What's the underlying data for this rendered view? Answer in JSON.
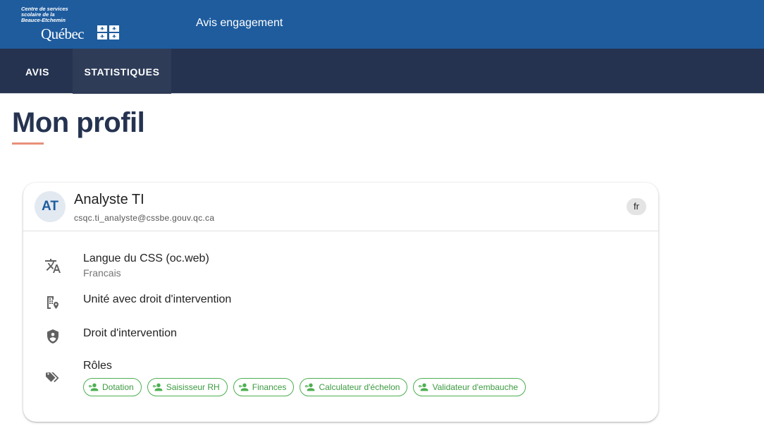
{
  "header": {
    "logo": {
      "org_line1": "Centre de services",
      "org_line2": "scolaire de la",
      "org_line3": "Beauce-Etchemin",
      "wordmark": "Québec"
    },
    "app_title": "Avis engagement",
    "color": "#1e5c9e"
  },
  "nav": {
    "items": [
      {
        "label": "AVIS"
      },
      {
        "label": "STATISTIQUES"
      }
    ],
    "color": "#253350"
  },
  "page": {
    "title": "Mon profil",
    "accent_color": "#e8907a"
  },
  "profile": {
    "initials": "AT",
    "name": "Analyste TI",
    "email": "csqc.ti_analyste@cssbe.gouv.qc.ca",
    "language_chip": "fr",
    "rows": [
      {
        "icon": "translate-icon",
        "label": "Langue du CSS (oc.web)",
        "value": "Francais"
      },
      {
        "icon": "building-location-icon",
        "label": "Unité avec droit d'intervention"
      },
      {
        "icon": "shield-person-icon",
        "label": "Droit d'intervention"
      },
      {
        "icon": "tags-icon",
        "label": "Rôles"
      }
    ],
    "roles": [
      {
        "label": "Dotation",
        "icon": "person-key-icon"
      },
      {
        "label": "Saisisseur RH",
        "icon": "person-key-icon"
      },
      {
        "label": "Finances",
        "icon": "person-key-icon"
      },
      {
        "label": "Calculateur d'échelon",
        "icon": "person-key-icon"
      },
      {
        "label": "Validateur d'embauche",
        "icon": "person-key-icon"
      }
    ],
    "role_color": "#4caf50"
  }
}
